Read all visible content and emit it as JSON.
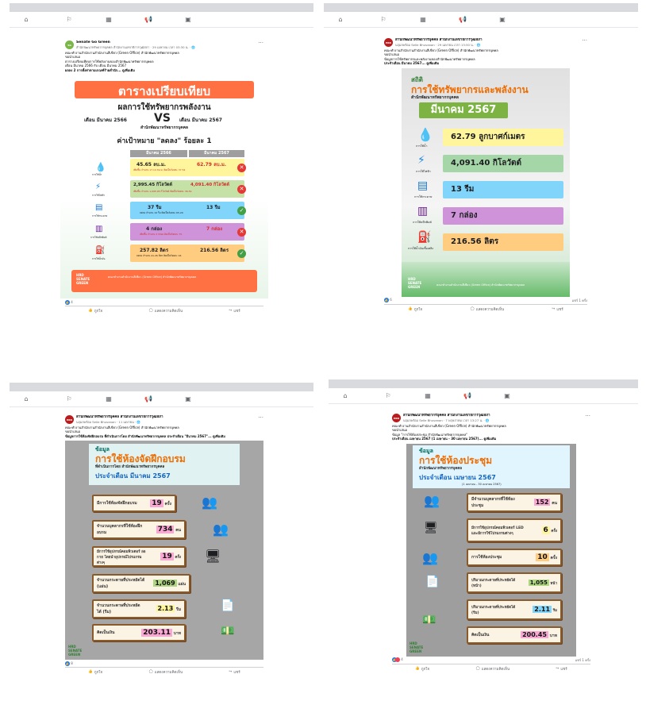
{
  "nav_icons": [
    "home-icon",
    "flag-icon",
    "store-icon",
    "megaphone-icon",
    "tv-icon"
  ],
  "posts": [
    {
      "page": "Senate Go Green",
      "meta": "สำนักพัฒนาทรัพยากรบุคคล สำนักงานเลขาธิการวุฒิสภา · 29 เมษายน เวลา 03:30 น. · 🌐",
      "text1": "คณะทำงานสำนักงานสำนักงานสีเขียว (Green Office) สำนักพัฒนาทรัพยากรบุคคล",
      "text2": "ขอนำเสนอ",
      "text3": "ตารางเปรียบเทียบการใช้พลังงานของสำนักพัฒนาทรัพยากรบุคคล",
      "text4": "เดือน มีนาคม 2566 กับ เดือน มีนาคม 2567",
      "text5": "ผลลง 2 การตั้งค่าตามเกณฑ์ร้ายต่ำนัก... ดูเพิ่มเติม",
      "ig": {
        "title1": "ตารางเปรียบเทียบ",
        "title2": "ผลการใช้ทรัพยากรพลังงาน",
        "month_a": "เดือน มีนาคม 2566",
        "vs": "VS",
        "month_b": "เดือน มีนาคม 2567",
        "org": "สำนักพัฒนาทรัพยากรบุคคล",
        "target": "ค่าเป้าหมาย \"ลดลง\" ร้อยละ 1",
        "col_a": "มีนาคม 2566",
        "col_b": "มีนาคม 2567",
        "rows": [
          {
            "label": "การใช้น้ำ",
            "a": "45.65 ลบ.ม.",
            "b": "62.79 ลบ.ม.",
            "note": "เพิ่มขึ้น จำนวน 17.14 ลบ.ม. คิดเป็นร้อยละ 37.54",
            "ok": false,
            "color": "#fff59d"
          },
          {
            "label": "การใช้ไฟฟ้า",
            "a": "2,995.45 กิโลวัตต์",
            "b": "4,091.40 กิโลวัตต์",
            "note": "เพิ่มขึ้น จำนวน 1,095.95 กิโลวัตต์ คิดเป็นร้อยละ 36.59",
            "ok": false,
            "color": "#c5e1a5"
          },
          {
            "label": "การใช้กระดาษ",
            "a": "37 รีม",
            "b": "13 รีม",
            "note": "ลดลง จำนวน 19 รีม คิดเป็นร้อยละ 65.29",
            "ok": true,
            "color": "#81d4fa"
          },
          {
            "label": "การใช้หมึกพิมพ์",
            "a": "4 กล่อง",
            "b": "7 กล่อง",
            "note": "เพิ่มขึ้น จำนวน 3 กล่อง คิดเป็นร้อยละ 75",
            "ok": false,
            "color": "#ce93d8"
          },
          {
            "label": "การใช้น้ำมัน",
            "a": "257.82 ลิตร",
            "b": "216.56 ลิตร",
            "note": "ลดลง จำนวน 41.26 ลิตร คิดเป็นร้อยละ 16",
            "ok": true,
            "color": "#ffcc80"
          }
        ],
        "footer": "คณะทำงานสำนักงานสีเขียว (Green Office) สำนักพัฒนาทรัพยากรบุคคล"
      },
      "reactions": "4",
      "shares": "",
      "like": "ถูกใจ",
      "comment": "แสดงความคิดเห็น",
      "share": "แชร์"
    },
    {
      "page": "สำนักพัฒนาทรัพยากรบุคคล สำนักงานเลขาธิการวุฒิสภา",
      "meta": "นฤมลพร้อม Selle Bhuvanan · 29 เมษายน เวลา 13:50 น. · 🌐",
      "text1": "คณะทำงานสำนักงานสำนักงานสีเขียว (Green Office) สำนักพัฒนาทรัพยากรบุคคล",
      "text2": "ขอนำเสนอ",
      "text3": "ข้อมูลการใช้ทรัพยากรและพลังงานของสำนักพัฒนาทรัพยากรบุคคล",
      "text4": "ประจำเดือน มีนาคม 2567... ดูเพิ่มเติม",
      "ig": {
        "title1": "สถิติ",
        "title2": "การใช้ทรัพยากรและพลังงาน",
        "org": "สำนักพัฒนาทรัพยากรบุคคล",
        "month": "มีนาคม 2567",
        "items": [
          {
            "label": "การใช้น้ำ",
            "value": "62.79 ลูกบาศก์เมตร",
            "color": "#fff59d",
            "icon": "water-drop-icon"
          },
          {
            "label": "การใช้ไฟฟ้า",
            "value": "4,091.40 กิโลวัตต์",
            "color": "#a5d6a7",
            "icon": "lightning-icon"
          },
          {
            "label": "การใช้กระดาษ",
            "value": "13 รีม",
            "color": "#81d4fa",
            "icon": "paper-icon"
          },
          {
            "label": "การใช้หมึกพิมพ์",
            "value": "7 กล่อง",
            "color": "#ce93d8",
            "icon": "ink-icon"
          },
          {
            "label": "การใช้น้ำมันเชื้อเพลิง",
            "value": "216.56 ลิตร",
            "color": "#ffcc80",
            "icon": "fuel-icon"
          }
        ],
        "footer": "คณะทำงานสำนักงานสีเขียว (Green Office) สำนักพัฒนาทรัพยากรบุคคล"
      },
      "reactions": "6",
      "shares": "แชร์ 1 ครั้ง",
      "like": "ถูกใจ",
      "comment": "แสดงความคิดเห็น",
      "share": "แชร์"
    },
    {
      "page": "สำนักพัฒนาทรัพยากรบุคคล สำนักงานเลขาธิการวุฒิสภา",
      "meta": "นฤมลพร้อม Selle Bhuvanan · 11 เมษายน · 🌐",
      "text1": "คณะทำงานสำนักงานสำนักงานสีเขียว (Green Office) สำนักพัฒนาทรัพยากรบุคคล",
      "text2": "ขอนำเสนอ",
      "text3": "ข้อมูลการใช้ห้องจัดฝึกอบรม ที่ดำเนินการโดย สำนักพัฒนาทรัพยากรบุคคล ประจำเดือน \"มีนาคม 2567\"... ดูเพิ่มเติม",
      "ig": {
        "title1": "ข้อมูล",
        "title2": "การใช้ห้องจัดฝึกอบรม",
        "sub": "ที่ดำเนินการโดย สำนักพัฒนาทรัพยากรบุคคล",
        "month": "ประจำเดือน มีนาคม 2567",
        "items": [
          {
            "label": "มีการใช้ห้องจัดฝึกอบรม",
            "value": "19",
            "unit": "ครั้ง"
          },
          {
            "label": "จำนวนบุคลากรที่ใช้ห้องฝึกอบรม",
            "value": "734",
            "unit": "คน"
          },
          {
            "label": "มีการใช้อุปกรณ์คอมพิวเตอร์ ออกาย โดยนำอุปกรณ์ไปรแกรมต่างๆ",
            "value": "19",
            "unit": "ครั้ง"
          },
          {
            "label": "จำนวนกระดาษที่ประหยัดได้ (แผ่น)",
            "value": "1,069",
            "unit": "แผ่น"
          },
          {
            "label": "จำนวนกระดาษที่ประหยัดได้ (รีม)",
            "value": "2.13",
            "unit": "รีม"
          },
          {
            "label": "คิดเป็นเงิน",
            "value": "203.11",
            "unit": "บาท"
          }
        ]
      },
      "reactions": "8",
      "shares": "",
      "like": "ถูกใจ",
      "comment": "แสดงความคิดเห็น",
      "share": "แชร์"
    },
    {
      "page": "สำนักพัฒนาทรัพยากรบุคคล สำนักงานเลขาธิการวุฒิสภา",
      "meta": "นฤมลพร้อม Selle Bhuvanan · 7 พฤษภาคม เวลา 13:27 น. · 🌐",
      "text1": "คณะทำงานสำนักงานสำนักงานสีเขียว (Green Office) สำนักพัฒนาทรัพยากรบุคคล",
      "text2": "ขอนำเสนอ",
      "text3": "ข้อมูล \"การใช้ห้องประชุม สำนักพัฒนาทรัพยากรบุคคล\"",
      "text4": "ประจำเดือน เมษายน 2567 (1 เมษายน - 30 เมษายน 2567)... ดูเพิ่มเติม",
      "ig": {
        "title1": "ข้อมูล",
        "title2": "การใช้ห้องประชุม",
        "sub": "สำนักพัฒนาทรัพยากรบุคคล",
        "month": "ประจำเดือน เมษายน 2567",
        "range": "(1 เมษายน - 30 เมษายน 2567)",
        "items": [
          {
            "label": "มีจำนวนบุคลากรที่ใช้ห้องประชุม",
            "value": "152",
            "unit": "คน"
          },
          {
            "label": "มีการใช้อุปกรณ์คอมพิวเตอร์ LED และมีการใช้โปรแกรมต่างๆ",
            "value": "6",
            "unit": "ครั้ง"
          },
          {
            "label": "การใช้ห้องประชุม",
            "value": "10",
            "unit": "ครั้ง"
          },
          {
            "label": "ปริมาณกระดาษที่ประหยัดได้ (หน้า)",
            "value": "1,055",
            "unit": "หน้า"
          },
          {
            "label": "ปริมาณกระดาษที่ประหยัดได้ (รีม)",
            "value": "2.11",
            "unit": "รีม"
          },
          {
            "label": "คิดเป็นเงิน",
            "value": "200.45",
            "unit": "บาท"
          }
        ]
      },
      "reactions": "4",
      "shares": "แชร์ 1 ครั้ง",
      "like": "ถูกใจ",
      "comment": "แสดงความคิดเห็น",
      "share": "แชร์"
    }
  ]
}
